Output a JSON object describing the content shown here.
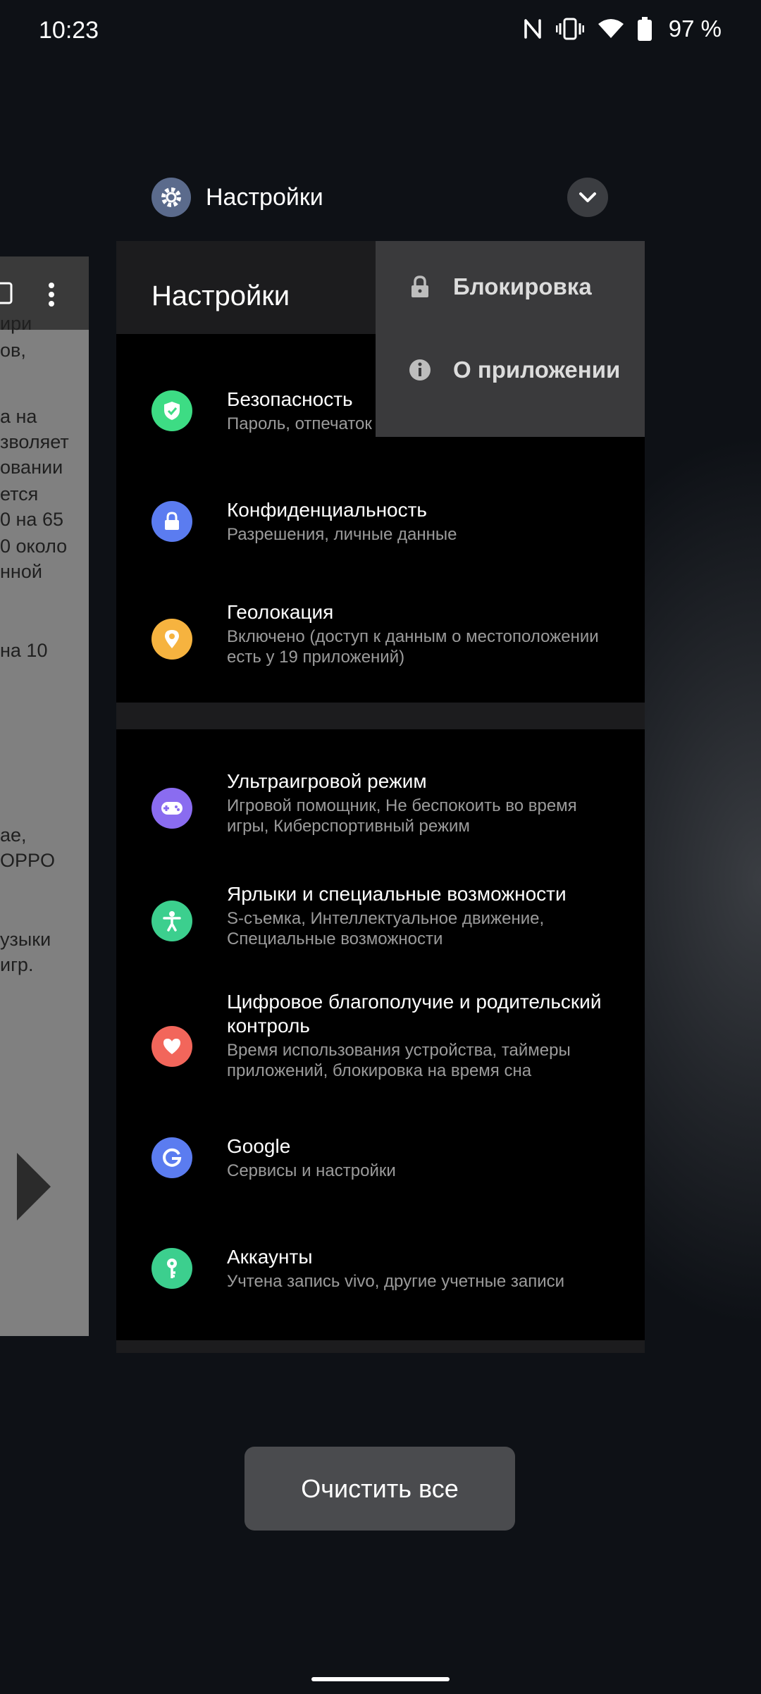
{
  "status_bar": {
    "time": "10:23",
    "battery": "97 %"
  },
  "left_card": {
    "snippets": [
      "ири",
      "ов,",
      "а на",
      "зволяет",
      "овании",
      "ется",
      "0 на 65",
      "0 около",
      "нной",
      "на 10",
      "ае,",
      "OPPO",
      "узыки",
      "игр."
    ]
  },
  "app_header": {
    "title": "Настройки",
    "icon": "gear-icon"
  },
  "card": {
    "toolbar_title": "Настройки",
    "items": [
      {
        "title": "Безопасность",
        "subtitle": "Пароль, отпечаток",
        "icon": "shield-icon",
        "color": "#3ddc84"
      },
      {
        "title": "Конфиденциальность",
        "subtitle": "Разрешения, личные данные",
        "icon": "lock-icon",
        "color": "#5b7cf0"
      },
      {
        "title": "Геолокация",
        "subtitle": "Включено (доступ к данным о местоположении есть у 19 приложений)",
        "icon": "location-icon",
        "color": "#f6b33f"
      },
      {
        "title": "Ультраигровой режим",
        "subtitle": "Игровой помощник, Не беспокоить во время игры, Киберспортивный режим",
        "icon": "gamepad-icon",
        "color": "#8a6cf0"
      },
      {
        "title": "Ярлыки и специальные возможности",
        "subtitle": "S-съемка, Интеллектуальное движение, Специальные возможности",
        "icon": "accessibility-icon",
        "color": "#3ccf8e"
      },
      {
        "title": "Цифровое благополучие и родительский контроль",
        "subtitle": "Время использования устройства, таймеры приложений, блокировка на время сна",
        "icon": "heart-icon",
        "color": "#f2665b"
      },
      {
        "title": "Google",
        "subtitle": "Сервисы и настройки",
        "icon": "google-icon",
        "color": "#5b7cf0"
      },
      {
        "title": "Аккаунты",
        "subtitle": "Учтена запись vivo, другие учетные записи",
        "icon": "key-icon",
        "color": "#3ccf8e"
      }
    ]
  },
  "menu": {
    "items": [
      {
        "label": "Блокировка",
        "icon": "lock-icon"
      },
      {
        "label": "О приложении",
        "icon": "info-icon"
      }
    ]
  },
  "clear_all": "Очистить все"
}
